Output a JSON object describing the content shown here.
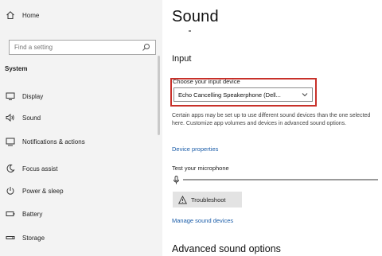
{
  "sidebar": {
    "home_label": "Home",
    "search_placeholder": "Find a setting",
    "section_label": "System",
    "items": [
      {
        "label": "Display",
        "icon": "display-icon"
      },
      {
        "label": "Sound",
        "icon": "speaker-icon"
      },
      {
        "label": "Notifications & actions",
        "icon": "notifications-icon"
      },
      {
        "label": "Focus assist",
        "icon": "moon-icon"
      },
      {
        "label": "Power & sleep",
        "icon": "power-icon"
      },
      {
        "label": "Battery",
        "icon": "battery-icon"
      },
      {
        "label": "Storage",
        "icon": "storage-icon"
      }
    ]
  },
  "main": {
    "title": "Sound",
    "input_heading": "Input",
    "choose_label": "Choose your input device",
    "selected_device": "Echo Cancelling Speakerphone (Dell...",
    "description": "Certain apps may be set up to use different sound devices than the one selected here. Customize app volumes and devices in advanced sound options.",
    "device_properties_link": "Device properties",
    "test_label": "Test your microphone",
    "troubleshoot_label": "Troubleshoot",
    "manage_link": "Manage sound devices",
    "advanced_heading": "Advanced sound options"
  },
  "colors": {
    "highlight_border": "#c8312a",
    "link": "#1a5ca8",
    "sidebar_bg": "#f3f3f3"
  }
}
